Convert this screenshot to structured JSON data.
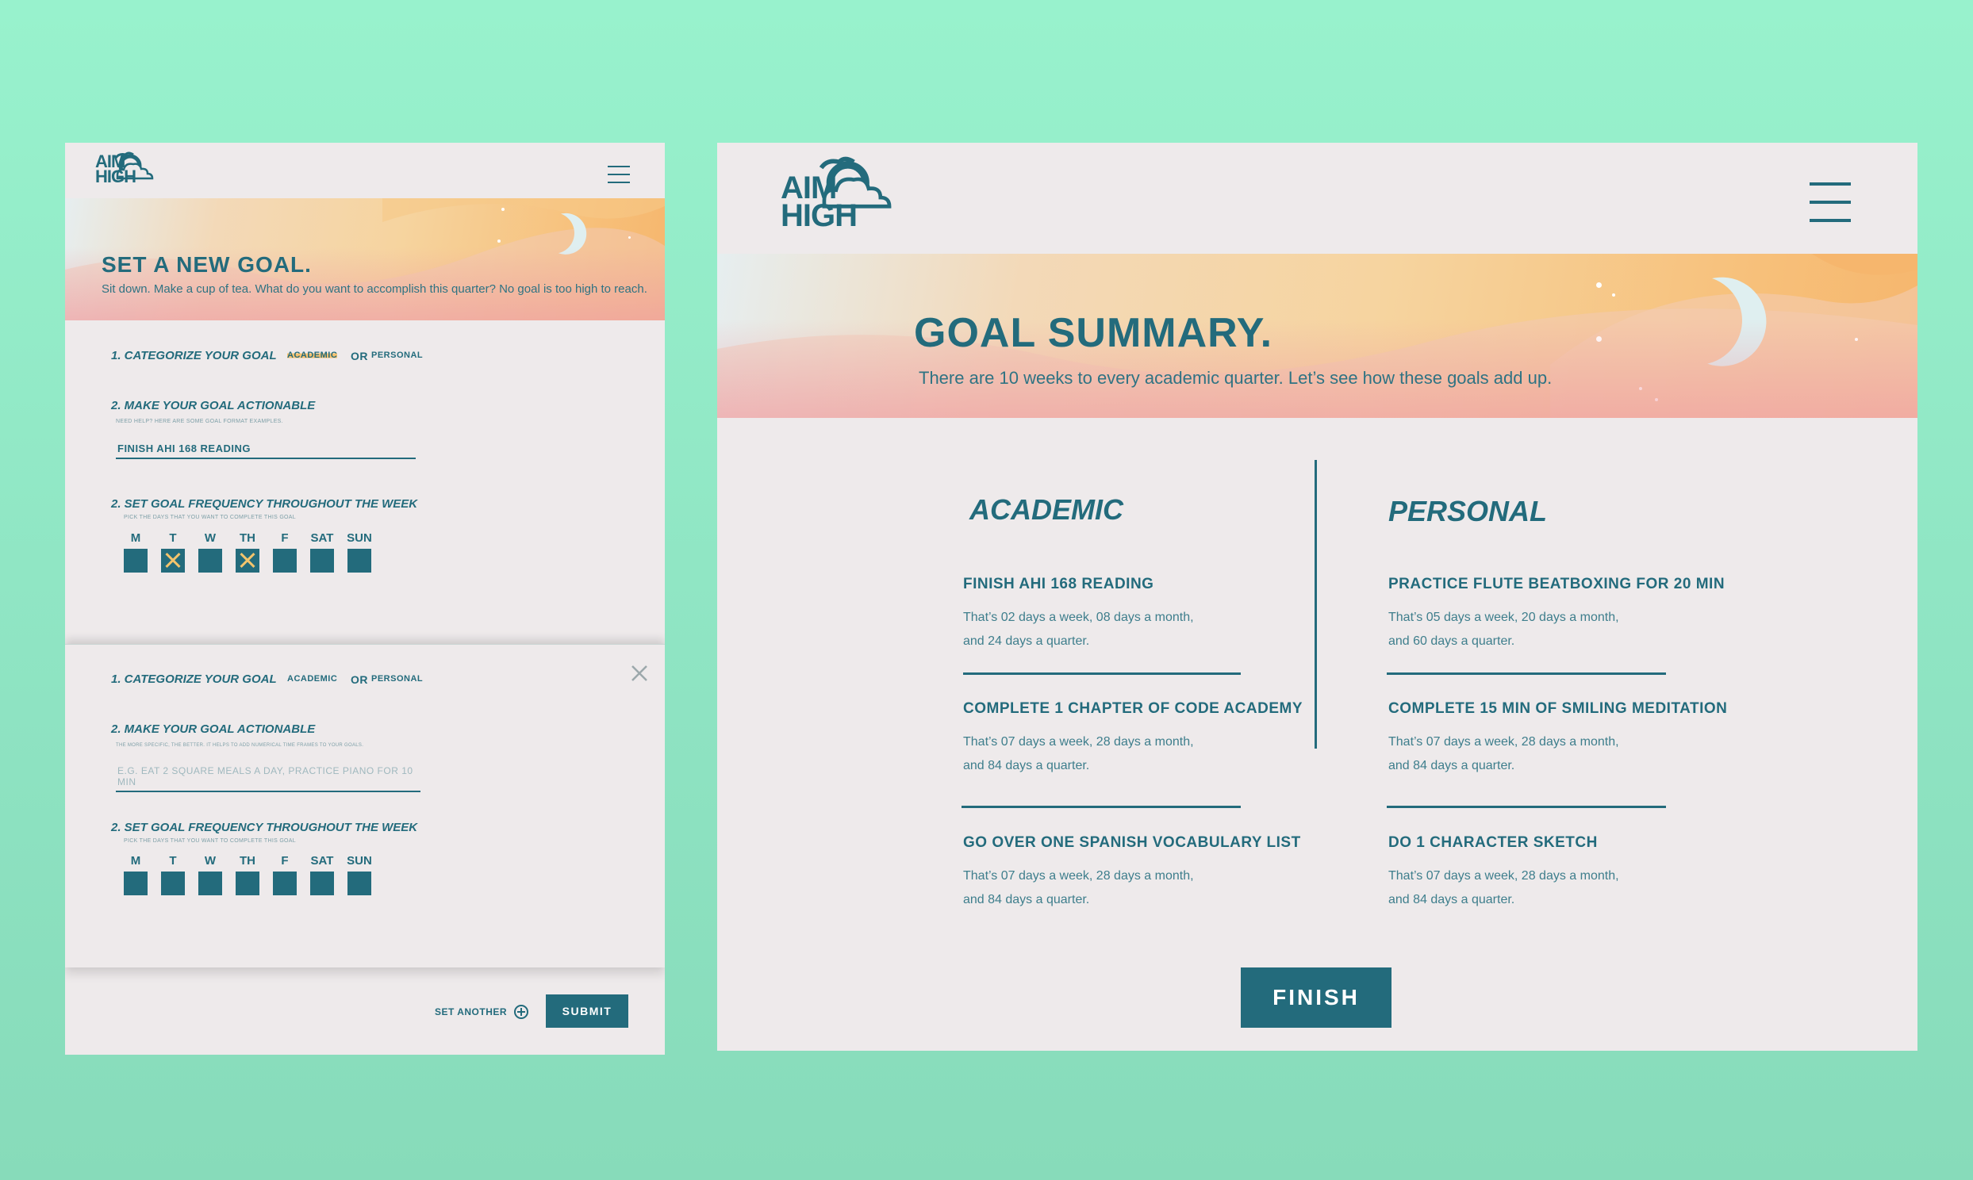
{
  "left_panel": {
    "logo": {
      "line1": "AIM",
      "line2": "HIGH"
    },
    "banner": {
      "title": "SET A NEW GOAL.",
      "subtitle": "Sit down. Make a cup of tea. What do you want to accomplish this quarter? No goal is too high to reach."
    },
    "goal_forms": [
      {
        "step1_label": "1. CATEGORIZE YOUR GOAL",
        "option_academic": "ACADEMIC",
        "or_text": "OR",
        "option_personal": "PERSONAL",
        "selected": "ACADEMIC",
        "step2_label": "2. MAKE YOUR GOAL ACTIONABLE",
        "step2_hint": "NEED HELP? HERE ARE SOME GOAL FORMAT EXAMPLES.",
        "input_value": "FINISH AHI 168 READING",
        "input_placeholder": "",
        "step3_label": "2. SET GOAL FREQUENCY THROUGHOUT THE WEEK",
        "step3_hint": "PICK THE DAYS THAT YOU WANT TO COMPLETE THIS GOAL",
        "days": [
          "M",
          "T",
          "W",
          "TH",
          "F",
          "SAT",
          "SUN"
        ],
        "checked": [
          false,
          true,
          false,
          true,
          false,
          false,
          false
        ]
      },
      {
        "step1_label": "1. CATEGORIZE YOUR GOAL",
        "option_academic": "ACADEMIC",
        "or_text": "OR",
        "option_personal": "PERSONAL",
        "selected": "",
        "step2_label": "2. MAKE YOUR GOAL ACTIONABLE",
        "step2_hint": "THE MORE SPECIFIC, THE BETTER. IT HELPS TO ADD NUMERICAL TIME FRAMES TO YOUR GOALS.",
        "input_value": "",
        "input_placeholder": "E.G. EAT 2 SQUARE MEALS A DAY, PRACTICE PIANO FOR 10 MIN",
        "step3_label": "2. SET GOAL FREQUENCY THROUGHOUT THE WEEK",
        "step3_hint": "PICK THE DAYS THAT YOU WANT TO COMPLETE THIS GOAL",
        "days": [
          "M",
          "T",
          "W",
          "TH",
          "F",
          "SAT",
          "SUN"
        ],
        "checked": [
          false,
          false,
          false,
          false,
          false,
          false,
          false
        ]
      }
    ],
    "footer": {
      "set_another": "SET ANOTHER",
      "submit": "SUBMIT"
    }
  },
  "right_panel": {
    "logo": {
      "line1": "AIM",
      "line2": "HIGH"
    },
    "banner": {
      "title": "GOAL SUMMARY.",
      "subtitle": "There are 10 weeks to every academic quarter. Let’s see how these goals add up."
    },
    "academic": {
      "heading": "ACADEMIC",
      "goals": [
        {
          "title": "FINISH AHI 168 READING",
          "line1": "That’s 02 days a week, 08 days a month,",
          "line2": "and 24 days a quarter."
        },
        {
          "title": "COMPLETE 1 CHAPTER OF CODE ACADEMY",
          "line1": "That’s 07 days a week, 28  days a month,",
          "line2": "and 84  days a quarter."
        },
        {
          "title": "GO OVER ONE SPANISH VOCABULARY LIST",
          "line1": "That’s 07 days a week, 28  days a month,",
          "line2": "and 84  days a quarter."
        }
      ]
    },
    "personal": {
      "heading": "PERSONAL",
      "goals": [
        {
          "title": "PRACTICE FLUTE BEATBOXING FOR 20 MIN",
          "line1": "That’s 05 days a week, 20 days a month,",
          "line2": "and 60 days a quarter."
        },
        {
          "title": "COMPLETE 15 MIN OF SMILING MEDITATION",
          "line1": "That’s 07 days a week, 28  days a month,",
          "line2": "and 84  days a quarter."
        },
        {
          "title": "DO 1 CHARACTER SKETCH",
          "line1": "That’s 07 days a week, 28  days a month,",
          "line2": "and 84  days a quarter."
        }
      ]
    },
    "finish_label": "FINISH"
  },
  "colors": {
    "primary": "#236b7c",
    "accent": "#f6c270",
    "background": "#98f2cd",
    "panel": "#eeeaeb"
  },
  "icons": [
    "logo-mark-icon",
    "hamburger-menu-icon",
    "close-icon",
    "plus-circle-icon",
    "moon-icon"
  ]
}
